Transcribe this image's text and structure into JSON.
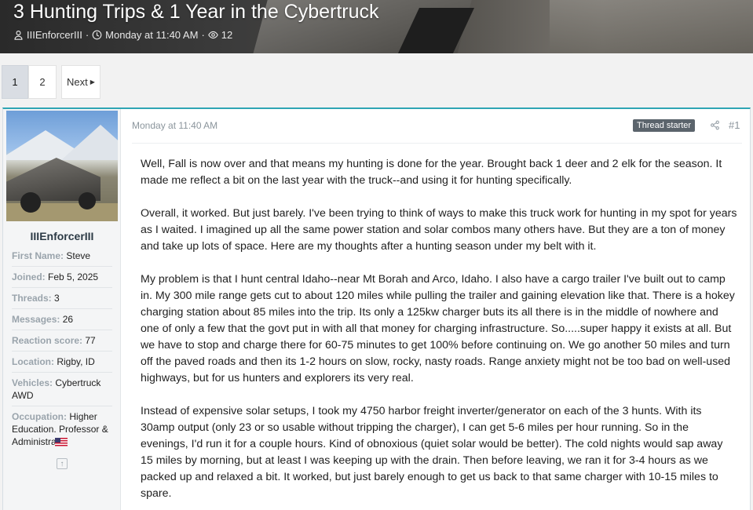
{
  "header": {
    "title": "3 Hunting Trips & 1 Year in the Cybertruck",
    "author": "IIIEnforcerIII",
    "date": "Monday at 11:40 AM",
    "views": "12",
    "icons": [
      "user-icon",
      "clock-icon",
      "eye-icon"
    ]
  },
  "pagination": {
    "pages": [
      "1",
      "2"
    ],
    "current": "1",
    "next_label": "Next"
  },
  "post": {
    "user": {
      "name": "IIIEnforcerIII",
      "fields": [
        {
          "label": "First Name:",
          "value": "Steve"
        },
        {
          "label": "Joined:",
          "value": "Feb 5, 2025"
        },
        {
          "label": "Threads:",
          "value": "3"
        },
        {
          "label": "Messages:",
          "value": "26"
        },
        {
          "label": "Reaction score:",
          "value": "77"
        },
        {
          "label": "Location:",
          "value": "Rigby, ID"
        },
        {
          "label": "Vehicles:",
          "value": "Cybertruck AWD"
        },
        {
          "label": "Occupation:",
          "value": "Higher Education. Professor & Administrator"
        }
      ]
    },
    "date": "Monday at 11:40 AM",
    "badge": "Thread starter",
    "number": "#1",
    "paragraphs": [
      "Well, Fall is now over and that means my hunting is done for the year. Brought back 1 deer and 2 elk for the season. It made me reflect a bit on the last year with the truck--and using it for hunting specifically.",
      "Overall, it worked. But just barely. I've been trying to think of ways to make this truck work for hunting in my spot for years as I waited. I imagined up all the same power station and solar combos many others have. But they are a ton of money and take up lots of space. Here are my thoughts after a hunting season under my belt with it.",
      "My problem is that I hunt central Idaho--near Mt Borah and Arco, Idaho. I also have a cargo trailer I've built out to camp in. My 300 mile range gets cut to about 120 miles while pulling the trailer and gaining elevation like that. There is a hokey charging station about 85 miles into the trip. Its only a 125kw charger buts its all there is in the middle of nowhere and one of only a few that the govt put in with all that money for charging infrastructure. So.....super happy it exists at all. But we have to stop and charge there for 60-75 minutes to get 100% before continuing on. We go another 50 miles and turn off the paved roads and then its 1-2 hours on slow, rocky, nasty roads. Range anxiety might not be too bad on well-used highways, but for us hunters and explorers its very real.",
      "Instead of expensive solar setups, I took my 4750 harbor freight inverter/generator on each of the 3 hunts. With its 30amp output (only 23 or so usable without tripping the charger), I can get 5-6 miles per hour running. So in the evenings, I'd run it for a couple hours. Kind of obnoxious (quiet solar would be better). The cold nights would sap away 15 miles by morning, but at least I was keeping up with the drain. Then before leaving, we ran it for 3-4 hours as we packed up and relaxed a bit. It worked, but just barely enough to get us back to that same charger with 10-15 miles to spare."
    ]
  },
  "colors": {
    "accent": "#2fa5b4",
    "badge": "#5b646c",
    "active_page": "#d9dde3"
  }
}
